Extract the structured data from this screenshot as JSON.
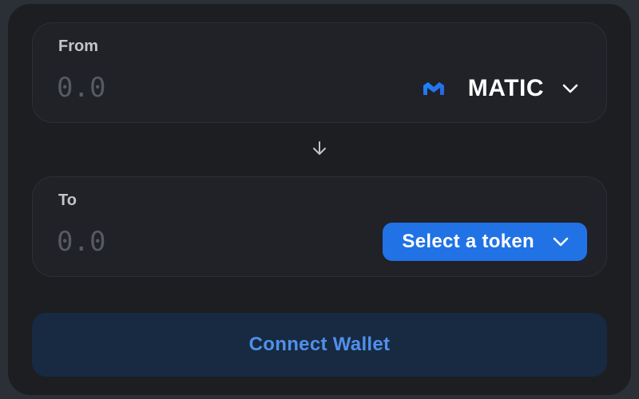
{
  "from": {
    "label": "From",
    "amount_placeholder": "0.0",
    "amount_value": "",
    "token": {
      "symbol": "MATIC",
      "icon": "matic-logo-icon",
      "icon_color": "#2b6def"
    }
  },
  "swap": {
    "icon": "arrow-down-icon"
  },
  "to": {
    "label": "To",
    "amount_placeholder": "0.0",
    "amount_value": "",
    "token_button": {
      "label": "Select a token",
      "icon": "chevron-down-icon",
      "color": "#2172e5"
    }
  },
  "actions": {
    "connect_label": "Connect Wallet",
    "connect_text_color": "#5090ea",
    "connect_bg_color": "#172a42"
  },
  "theme": {
    "page_bg": "#2b2f36",
    "card_bg": "#1c1e22",
    "panel_bg": "#202227"
  }
}
